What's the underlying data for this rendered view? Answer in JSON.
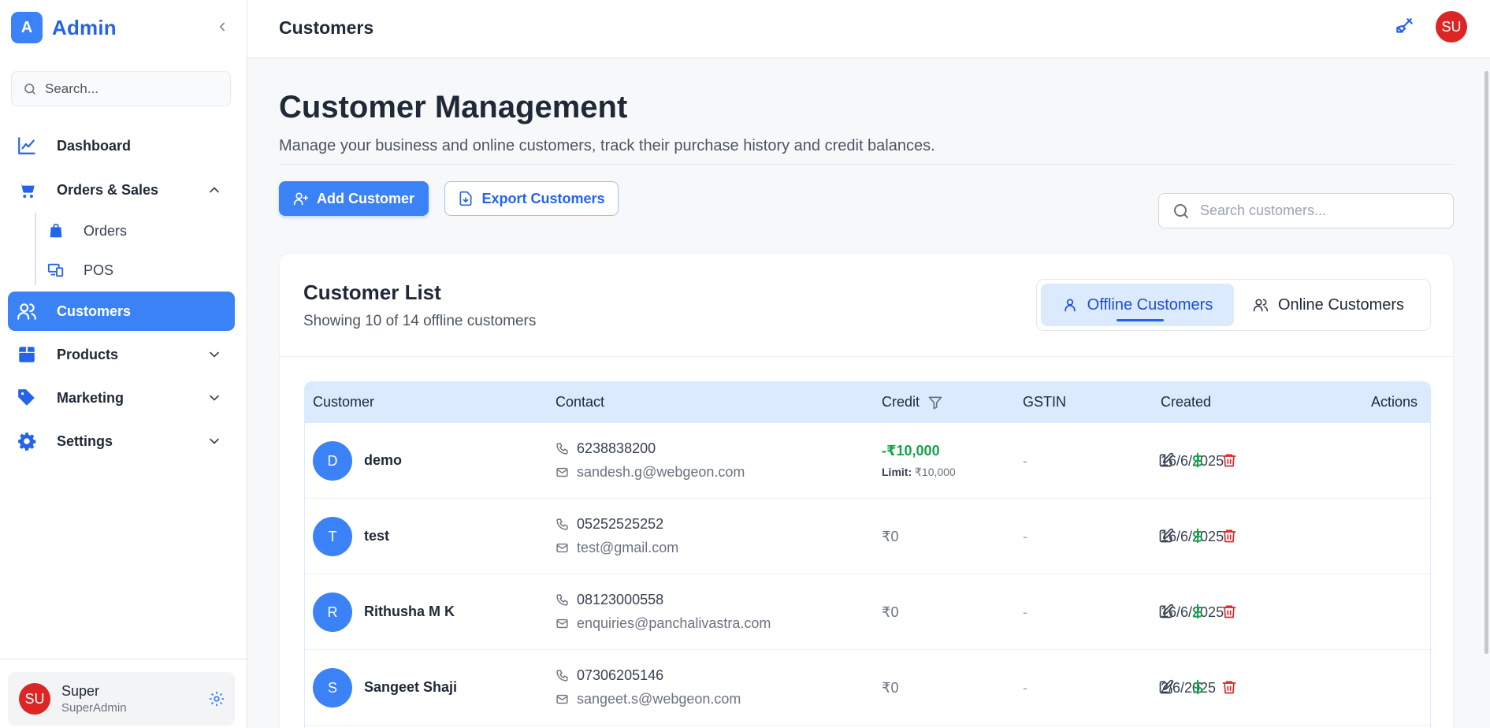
{
  "brand": {
    "logo_letter": "A",
    "name": "Admin"
  },
  "sidebar": {
    "search_placeholder": "Search...",
    "items": [
      {
        "label": "Dashboard",
        "icon": "chart-line-icon"
      },
      {
        "label": "Orders & Sales",
        "icon": "cart-icon",
        "expanded": true
      },
      {
        "label": "Customers",
        "icon": "users-icon",
        "active": true
      },
      {
        "label": "Products",
        "icon": "box-icon"
      },
      {
        "label": "Marketing",
        "icon": "tag-icon"
      },
      {
        "label": "Settings",
        "icon": "gear-icon"
      }
    ],
    "sub_items": [
      {
        "label": "Orders",
        "icon": "bag-icon"
      },
      {
        "label": "POS",
        "icon": "devices-icon"
      }
    ],
    "user": {
      "initials": "SU",
      "name": "Super",
      "role": "SuperAdmin"
    }
  },
  "topbar": {
    "title": "Customers",
    "avatar_initials": "SU"
  },
  "main": {
    "title": "Customer Management",
    "subtitle": "Manage your business and online customers, track their purchase history and credit balances.",
    "add_button": "Add Customer",
    "export_button": "Export Customers",
    "search_placeholder": "Search customers..."
  },
  "card": {
    "title": "Customer List",
    "subtitle": "Showing 10 of 14 offline customers",
    "tabs": {
      "offline": "Offline Customers",
      "online": "Online Customers"
    }
  },
  "table": {
    "headers": {
      "customer": "Customer",
      "contact": "Contact",
      "credit": "Credit",
      "gstin": "GSTIN",
      "created": "Created",
      "actions": "Actions"
    },
    "limit_label": "Limit:",
    "rows": [
      {
        "initial": "D",
        "name": "demo",
        "phone": "6238838200",
        "email": "sandesh.g@webgeon.com",
        "credit": "-₹10,000",
        "limit": "₹10,000",
        "gstin": "-",
        "created": "16/6/2025"
      },
      {
        "initial": "T",
        "name": "test",
        "phone": "05252525252",
        "email": "test@gmail.com",
        "credit": "₹0",
        "gstin": "-",
        "created": "16/6/2025"
      },
      {
        "initial": "R",
        "name": "Rithusha M K",
        "phone": "08123000558",
        "email": "enquiries@panchalivastra.com",
        "credit": "₹0",
        "gstin": "-",
        "created": "16/6/2025"
      },
      {
        "initial": "S",
        "name": "Sangeet Shaji",
        "phone": "07306205146",
        "email": "sangeet.s@webgeon.com",
        "credit": "₹0",
        "gstin": "-",
        "created": "2/6/2025"
      }
    ]
  },
  "colors": {
    "primary": "#3b82f6",
    "danger": "#dc2626",
    "success": "#16a34a",
    "header_bg": "#dbeafe"
  }
}
